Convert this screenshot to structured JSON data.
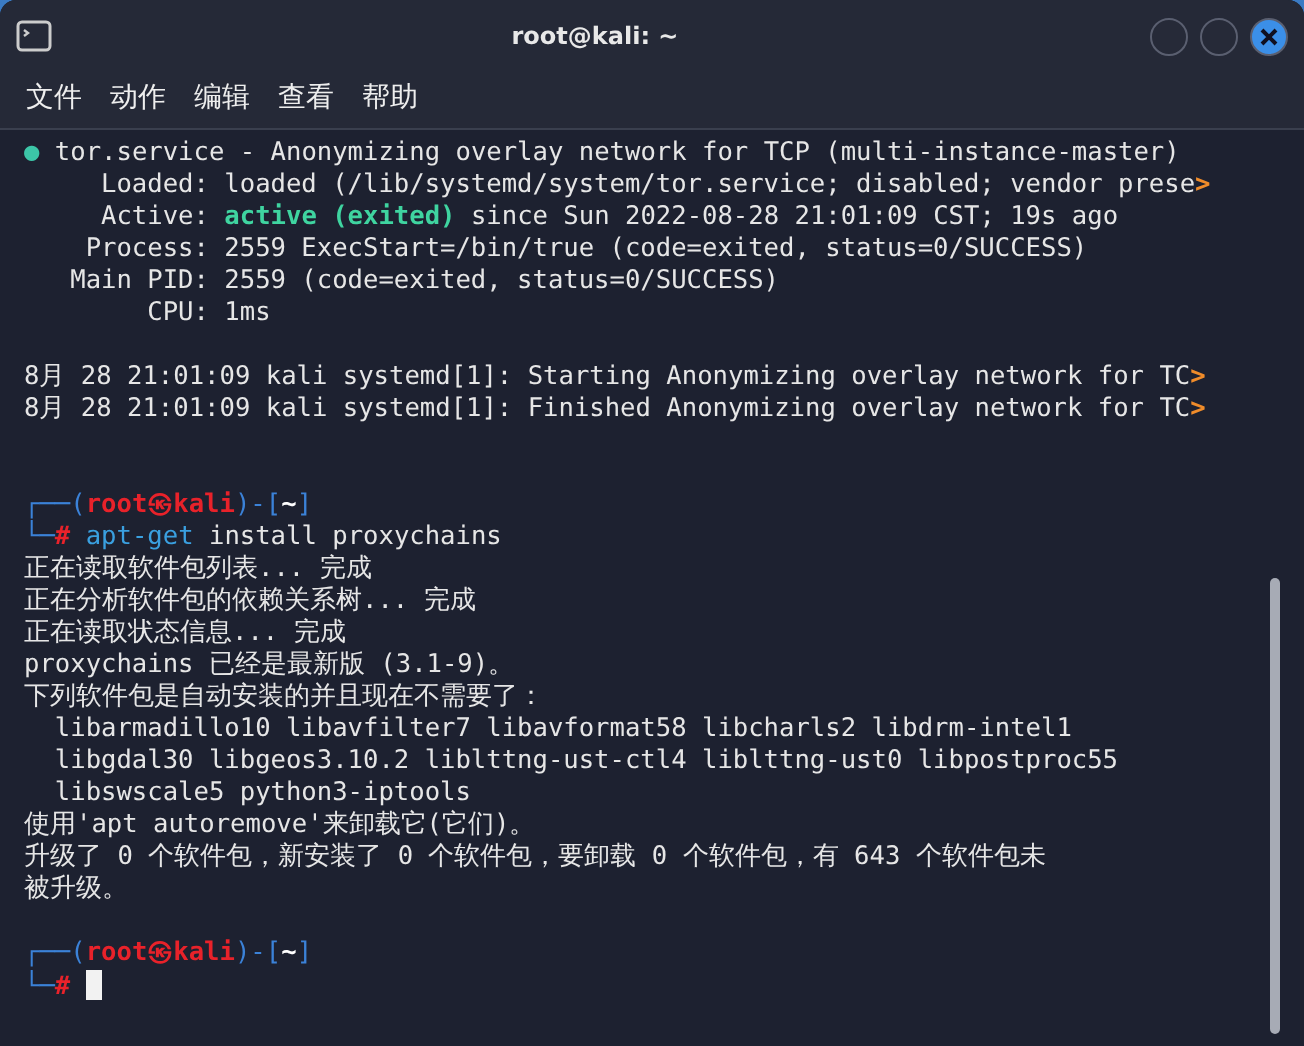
{
  "window": {
    "title": "root@kali: ~"
  },
  "menu": [
    "文件",
    "动作",
    "编辑",
    "查看",
    "帮助"
  ],
  "lines": [
    {
      "kind": "text",
      "segments": [
        {
          "kind": "dot",
          "text": "●"
        },
        {
          "kind": "plain",
          "text": " tor.service - Anonymizing overlay network for TCP (multi-instance-master)"
        }
      ]
    },
    {
      "kind": "text",
      "segments": [
        {
          "kind": "plain",
          "text": "     Loaded: loaded (/lib/systemd/system/tor.service; disabled; vendor prese"
        },
        {
          "kind": "cut",
          "text": ">"
        }
      ]
    },
    {
      "kind": "text",
      "segments": [
        {
          "kind": "plain",
          "text": "     Active: "
        },
        {
          "kind": "good",
          "text": "active (exited)"
        },
        {
          "kind": "plain",
          "text": " since Sun 2022-08-28 21:01:09 CST; 19s ago"
        }
      ]
    },
    {
      "kind": "text",
      "segments": [
        {
          "kind": "plain",
          "text": "    Process: 2559 ExecStart=/bin/true (code=exited, status=0/SUCCESS)"
        }
      ]
    },
    {
      "kind": "text",
      "segments": [
        {
          "kind": "plain",
          "text": "   Main PID: 2559 (code=exited, status=0/SUCCESS)"
        }
      ]
    },
    {
      "kind": "text",
      "segments": [
        {
          "kind": "plain",
          "text": "        CPU: 1ms"
        }
      ]
    },
    {
      "kind": "blank"
    },
    {
      "kind": "text",
      "segments": [
        {
          "kind": "plain",
          "text": "8月 28 21:01:09 kali systemd[1]: Starting Anonymizing overlay network for TC"
        },
        {
          "kind": "cut",
          "text": ">"
        }
      ]
    },
    {
      "kind": "text",
      "segments": [
        {
          "kind": "plain",
          "text": "8月 28 21:01:09 kali systemd[1]: Finished Anonymizing overlay network for TC"
        },
        {
          "kind": "cut",
          "text": ">"
        }
      ]
    },
    {
      "kind": "blank"
    },
    {
      "kind": "blank"
    },
    {
      "kind": "text",
      "segments": [
        {
          "kind": "frame",
          "text": "┌──("
        },
        {
          "kind": "user",
          "text": "root㉿kali"
        },
        {
          "kind": "frame",
          "text": ")-["
        },
        {
          "kind": "path",
          "text": "~"
        },
        {
          "kind": "frame",
          "text": "]"
        }
      ]
    },
    {
      "kind": "text",
      "segments": [
        {
          "kind": "frame",
          "text": "└─"
        },
        {
          "kind": "user",
          "text": "#"
        },
        {
          "kind": "command",
          "text": " apt-get"
        },
        {
          "kind": "plain",
          "text": " install proxychains"
        }
      ]
    },
    {
      "kind": "text",
      "segments": [
        {
          "kind": "plain",
          "text": "正在读取软件包列表... 完成"
        }
      ]
    },
    {
      "kind": "text",
      "segments": [
        {
          "kind": "plain",
          "text": "正在分析软件包的依赖关系树... 完成"
        }
      ]
    },
    {
      "kind": "text",
      "segments": [
        {
          "kind": "plain",
          "text": "正在读取状态信息... 完成"
        }
      ]
    },
    {
      "kind": "text",
      "segments": [
        {
          "kind": "plain",
          "text": "proxychains 已经是最新版 (3.1-9)。"
        }
      ]
    },
    {
      "kind": "text",
      "segments": [
        {
          "kind": "plain",
          "text": "下列软件包是自动安装的并且现在不需要了："
        }
      ]
    },
    {
      "kind": "text",
      "segments": [
        {
          "kind": "plain",
          "text": "  libarmadillo10 libavfilter7 libavformat58 libcharls2 libdrm-intel1"
        }
      ]
    },
    {
      "kind": "text",
      "segments": [
        {
          "kind": "plain",
          "text": "  libgdal30 libgeos3.10.2 liblttng-ust-ctl4 liblttng-ust0 libpostproc55"
        }
      ]
    },
    {
      "kind": "text",
      "segments": [
        {
          "kind": "plain",
          "text": "  libswscale5 python3-iptools"
        }
      ]
    },
    {
      "kind": "text",
      "segments": [
        {
          "kind": "plain",
          "text": "使用'apt autoremove'来卸载它(它们)。"
        }
      ]
    },
    {
      "kind": "text",
      "segments": [
        {
          "kind": "plain",
          "text": "升级了 0 个软件包，新安装了 0 个软件包，要卸载 0 个软件包，有 643 个软件包未"
        }
      ]
    },
    {
      "kind": "text",
      "segments": [
        {
          "kind": "plain",
          "text": "被升级。"
        }
      ]
    },
    {
      "kind": "blank"
    },
    {
      "kind": "text",
      "segments": [
        {
          "kind": "frame",
          "text": "┌──("
        },
        {
          "kind": "user",
          "text": "root㉿kali"
        },
        {
          "kind": "frame",
          "text": ")-["
        },
        {
          "kind": "path",
          "text": "~"
        },
        {
          "kind": "frame",
          "text": "]"
        }
      ]
    },
    {
      "kind": "prompt",
      "segments": [
        {
          "kind": "frame",
          "text": "└─"
        },
        {
          "kind": "user",
          "text": "#"
        }
      ]
    }
  ]
}
